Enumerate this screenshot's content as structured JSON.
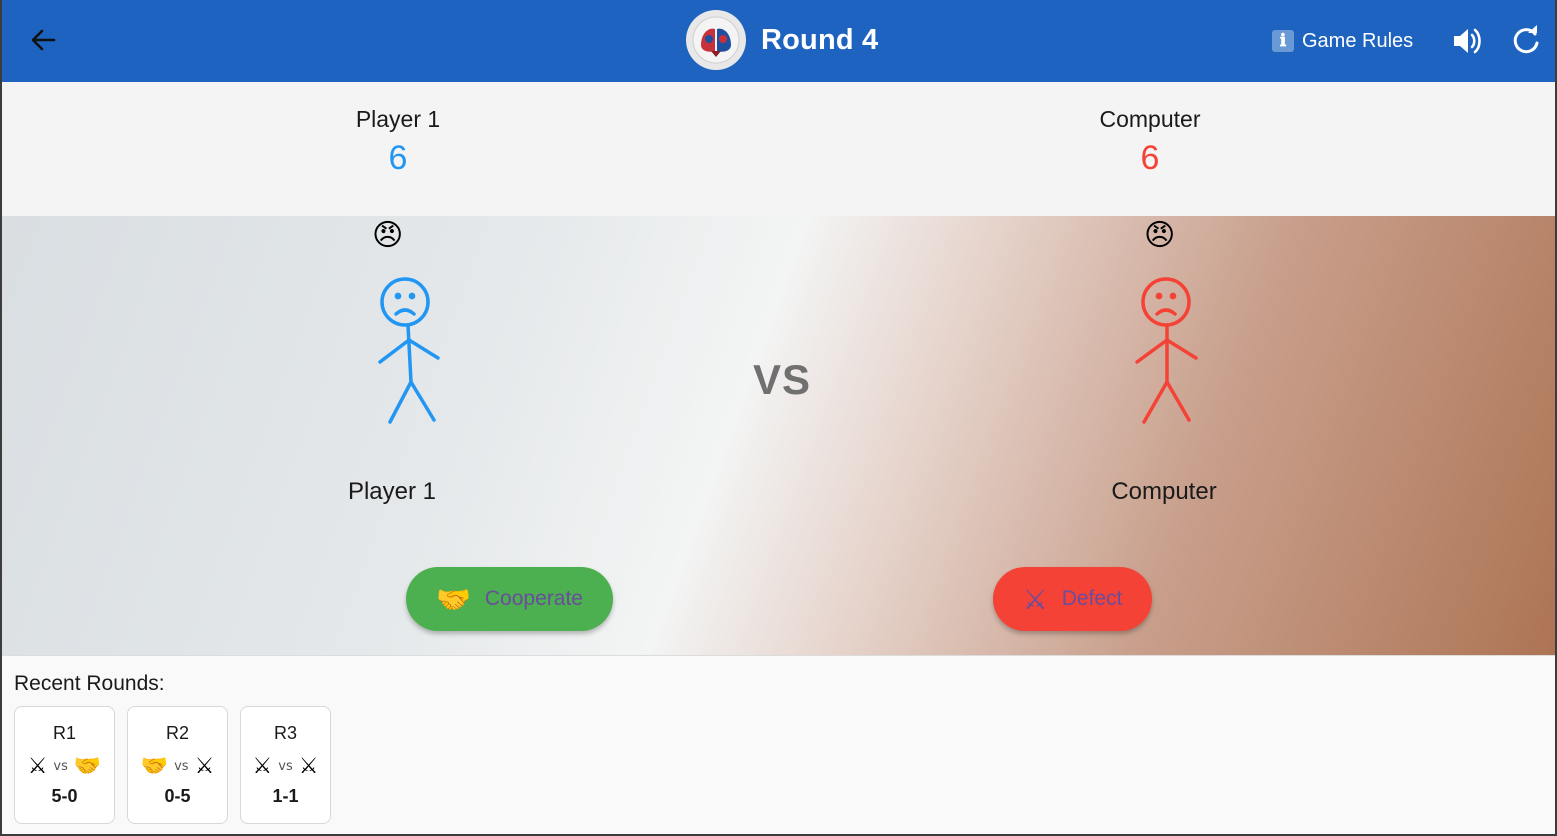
{
  "appbar": {
    "title": "Round 4",
    "rules_label": "Game Rules",
    "rules_icon": "ℹ"
  },
  "scores": {
    "player": {
      "name": "Player 1",
      "value": "6",
      "color": "#2196f3"
    },
    "computer": {
      "name": "Computer",
      "value": "6",
      "color": "#f44336"
    }
  },
  "arena": {
    "player_mood": "😠",
    "computer_mood": "😠",
    "vs_text": "VS",
    "player_name": "Player 1",
    "computer_name": "Computer"
  },
  "actions": {
    "cooperate": {
      "icon": "🤝",
      "label": "Cooperate",
      "color": "#4caf50"
    },
    "defect": {
      "icon": "⚔",
      "label": "Defect",
      "color": "#f44336"
    }
  },
  "recent": {
    "title": "Recent Rounds:",
    "vs_text": "vs",
    "rounds": [
      {
        "label": "R1",
        "player_move": "⚔",
        "computer_move": "🤝",
        "score": "5-0"
      },
      {
        "label": "R2",
        "player_move": "🤝",
        "computer_move": "⚔",
        "score": "0-5"
      },
      {
        "label": "R3",
        "player_move": "⚔",
        "computer_move": "⚔",
        "score": "1-1"
      }
    ]
  }
}
